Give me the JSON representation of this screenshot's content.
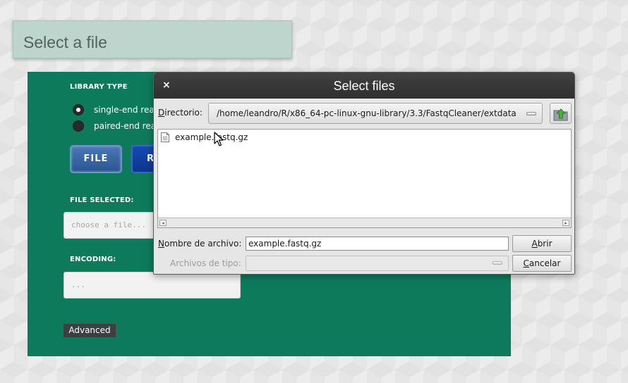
{
  "page": {
    "header_title": "Select a file"
  },
  "panel": {
    "library_type_label": "LIBRARY TYPE",
    "radio_single_label": "single-end reac",
    "radio_paired_label": "paired-end reac",
    "file_button_label": "FILE",
    "second_button_label": "R",
    "file_selected_label": "FILE SELECTED:",
    "file_field_placeholder": "choose a file...",
    "encoding_label": "ENCODING:",
    "encoding_field_placeholder": "...",
    "advanced_button_label": "Advanced",
    "selected_radio": "single-end"
  },
  "dialog": {
    "title": "Select files",
    "close_glyph": "×",
    "directory_label_accel": "D",
    "directory_label_rest": "irectorio:",
    "directory_path": "/home/leandro/R/x86_64-pc-linux-gnu-library/3.3/FastqCleaner/extdata",
    "files": [
      {
        "name": "example.fastq.gz"
      }
    ],
    "filename_label_accel": "N",
    "filename_label_rest": "ombre de archivo:",
    "filename_value": "example.fastq.gz",
    "filetype_label": "Archivos de tipo:",
    "open_button_accel": "A",
    "open_button_rest": "brir",
    "cancel_button_accel": "C",
    "cancel_button_rest": "ancelar"
  },
  "icons": {
    "close": "close-icon",
    "up_folder": "folder-up-icon",
    "file": "document-icon",
    "pointer": "mouse-pointer-icon"
  },
  "colors": {
    "panel_green": "#0e7a5c",
    "header_bg": "#bdd5cc",
    "file_button_blue": "#2a5592",
    "titlebar_dark": "#353535"
  }
}
